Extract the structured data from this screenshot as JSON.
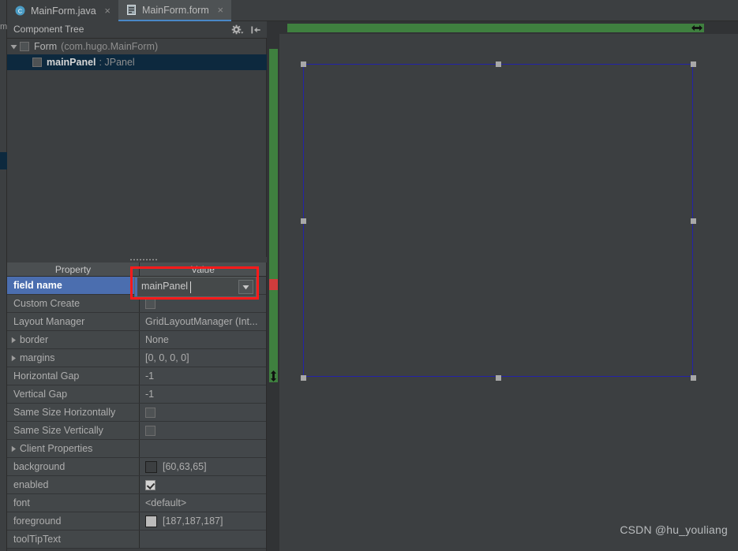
{
  "window": {
    "left_strip_label": "m"
  },
  "tabs": [
    {
      "label": "MainForm.java",
      "icon": "java-class-icon",
      "close": "×",
      "active": false
    },
    {
      "label": "MainForm.form",
      "icon": "form-file-icon",
      "close": "×",
      "active": true
    }
  ],
  "component_tree": {
    "title": "Component Tree",
    "icons": [
      {
        "name": "gear-icon"
      },
      {
        "name": "collapse-all-icon"
      }
    ],
    "rows": [
      {
        "arrow": "▼",
        "name": "Form",
        "detail": "(com.hugo.MainForm)",
        "selected": false
      },
      {
        "arrow": "",
        "name": "mainPanel",
        "detail": ": JPanel",
        "selected": true
      }
    ]
  },
  "properties": {
    "headers": {
      "property": "Property",
      "value": "Value"
    },
    "rows": [
      {
        "name": "field name",
        "indent": false,
        "expandable": false,
        "selected": true,
        "value_kind": "editor",
        "value": "mainPanel"
      },
      {
        "name": "Custom Create",
        "indent": false,
        "expandable": false,
        "selected": false,
        "value_kind": "checkbox",
        "value": "unchecked"
      },
      {
        "name": "Layout Manager",
        "indent": false,
        "expandable": false,
        "selected": false,
        "value_kind": "text",
        "value": "GridLayoutManager (Int..."
      },
      {
        "name": "border",
        "indent": true,
        "expandable": true,
        "selected": false,
        "value_kind": "text",
        "value": "None"
      },
      {
        "name": "margins",
        "indent": true,
        "expandable": true,
        "selected": false,
        "value_kind": "text",
        "value": "[0, 0, 0, 0]"
      },
      {
        "name": "Horizontal Gap",
        "indent": false,
        "expandable": false,
        "selected": false,
        "value_kind": "text",
        "value": "-1"
      },
      {
        "name": "Vertical Gap",
        "indent": false,
        "expandable": false,
        "selected": false,
        "value_kind": "text",
        "value": "-1"
      },
      {
        "name": "Same Size Horizontally",
        "indent": false,
        "expandable": false,
        "selected": false,
        "value_kind": "checkbox",
        "value": "unchecked"
      },
      {
        "name": "Same Size Vertically",
        "indent": false,
        "expandable": false,
        "selected": false,
        "value_kind": "checkbox",
        "value": "unchecked"
      },
      {
        "name": "Client Properties",
        "indent": true,
        "expandable": true,
        "selected": false,
        "value_kind": "text",
        "value": ""
      },
      {
        "name": "background",
        "indent": false,
        "expandable": false,
        "selected": false,
        "value_kind": "color",
        "value": "[60,63,65]",
        "swatch": "#3c3f41"
      },
      {
        "name": "enabled",
        "indent": false,
        "expandable": false,
        "selected": false,
        "value_kind": "checkbox",
        "value": "checked"
      },
      {
        "name": "font",
        "indent": false,
        "expandable": false,
        "selected": false,
        "value_kind": "text",
        "value": "<default>"
      },
      {
        "name": "foreground",
        "indent": false,
        "expandable": false,
        "selected": false,
        "value_kind": "color",
        "value": "[187,187,187]",
        "swatch": "#bbbbbb"
      },
      {
        "name": "toolTipText",
        "indent": false,
        "expandable": false,
        "selected": false,
        "value_kind": "text",
        "value": ""
      }
    ]
  },
  "editor_field": {
    "value": "mainPanel",
    "dropdown_icon": "chevron-down-icon",
    "annotation_color": "#ff1a1a"
  },
  "canvas": {
    "ruler_color": "#3f803f",
    "selection_border_color": "#2323a8",
    "handle_color": "#a8a8a8",
    "h_ruler_handle_icon": "horizontal-resize-icon",
    "v_ruler_handle_icon": "vertical-resize-icon"
  },
  "watermark": {
    "text": "CSDN @hu_youliang"
  }
}
